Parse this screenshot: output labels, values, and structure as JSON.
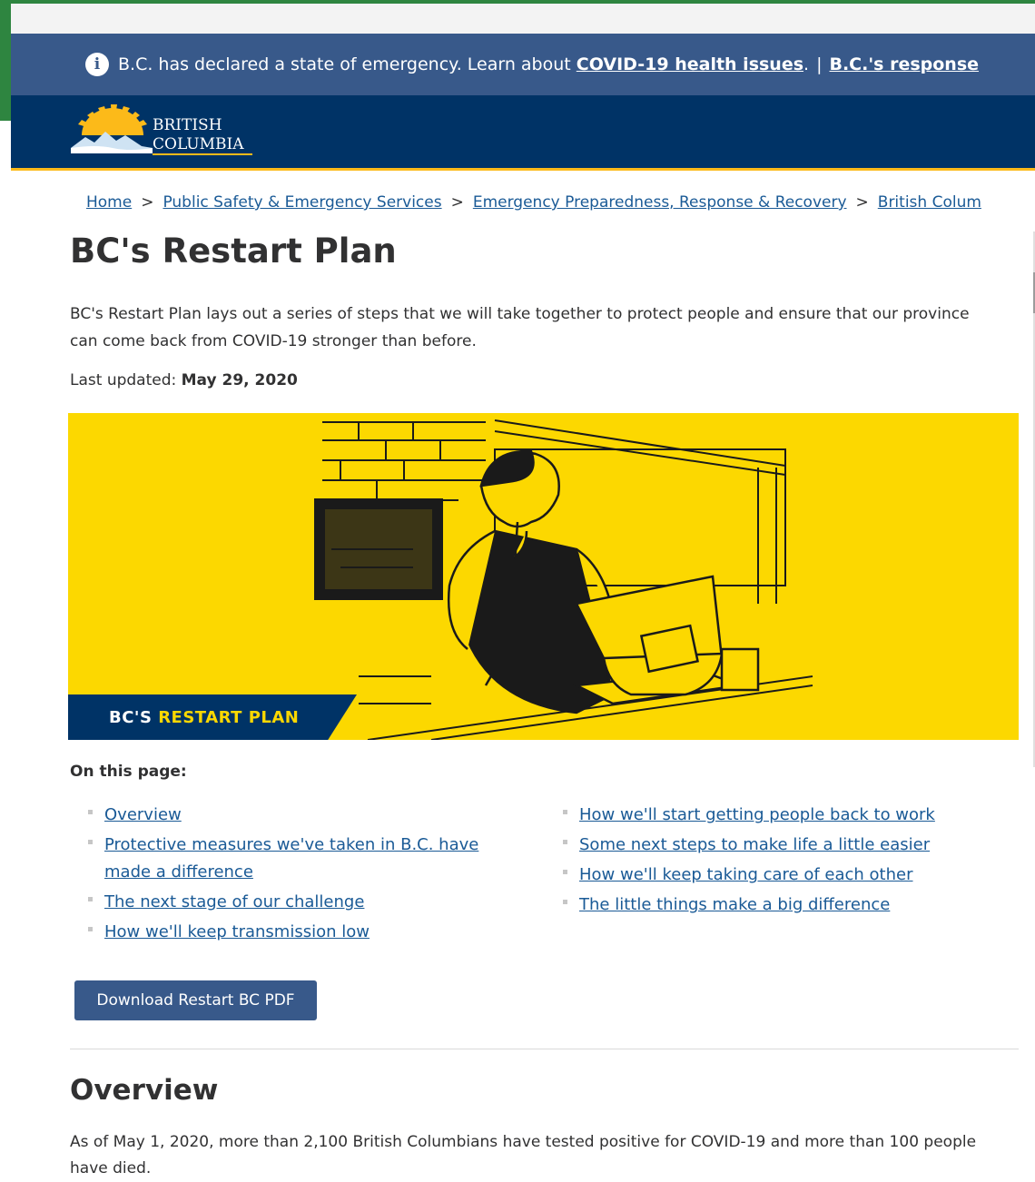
{
  "alert": {
    "prefix": "B.C. has declared a state of emergency. Learn about",
    "link_health": "COVID-19 health issues",
    "after_link": ".",
    "separator": "|",
    "link_response": "B.C.'s response"
  },
  "header": {
    "logo_line1": "BRITISH",
    "logo_line2": "COLUMBIA",
    "colors": {
      "navy": "#003366",
      "gold": "#fcba19"
    }
  },
  "breadcrumb": {
    "items": [
      "Home",
      "Public Safety & Emergency Services",
      "Emergency Preparedness, Response & Recovery",
      "British Colum"
    ],
    "separator": ">"
  },
  "page": {
    "title": "BC's Restart Plan",
    "intro": "BC's Restart Plan lays out a series of steps that we will take together to protect people and ensure that our province can come back from COVID-19 stronger than before.",
    "updated_label": "Last updated:",
    "updated_date": "May 29, 2020"
  },
  "hero": {
    "banner_prefix": "BC'S",
    "banner_highlight": "RESTART PLAN",
    "colors": {
      "background": "#fcd800",
      "banner": "#003366"
    }
  },
  "toc": {
    "label": "On this page:",
    "left": [
      "Overview",
      "Protective measures we've taken in B.C. have made a difference",
      "The next stage of our challenge",
      "How we'll keep transmission low"
    ],
    "right": [
      "How we'll start getting people back to work",
      "Some next steps to make life a little easier",
      "How we'll keep taking care of each other",
      "The little things make a big difference"
    ]
  },
  "download_button": "Download Restart BC PDF",
  "overview": {
    "heading": "Overview",
    "text": "As of May 1, 2020, more than 2,100 British Columbians have tested positive for COVID-19 and more than 100 people have died."
  }
}
